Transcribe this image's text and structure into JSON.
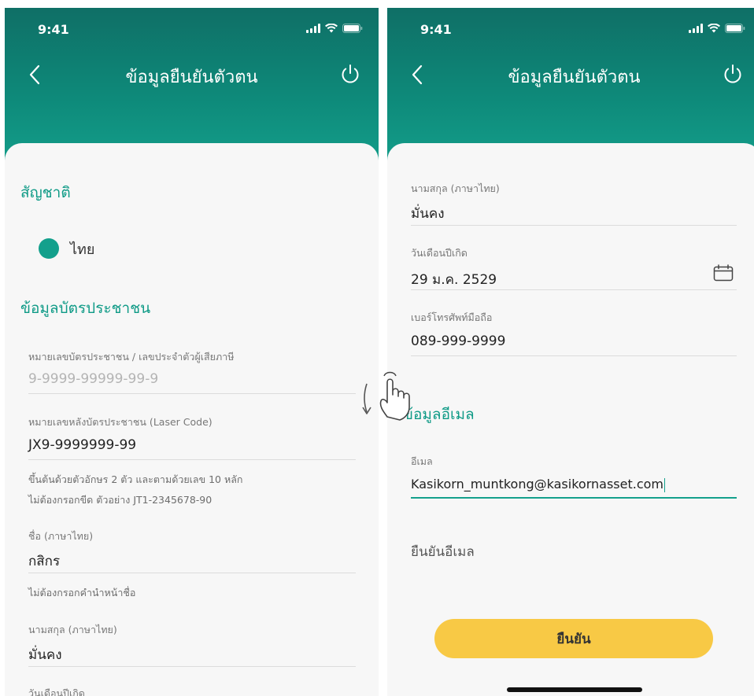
{
  "status_bar": {
    "time": "9:41"
  },
  "header": {
    "title": "ข้อมูลยืนยันตัวตน"
  },
  "left": {
    "nationality": {
      "title": "สัญชาติ",
      "option": "ไทย"
    },
    "id_section_title": "ข้อมูลบัตรประชาชน",
    "id_number": {
      "label": "หมายเลขบัตรประชาชน / เลขประจำตัวผู้เสียภาษี",
      "placeholder": "9-9999-99999-99-9"
    },
    "laser_code": {
      "label": "หมายเลขหลังบัตรประชาชน (Laser Code)",
      "value": "JX9-9999999-99",
      "hint1": "ขึ้นต้นด้วยตัวอักษร 2 ตัว และตามด้วยเลข 10 หลัก",
      "hint2": "ไม่ต้องกรอกขีด  ตัวอย่าง JT1-2345678-90"
    },
    "first_name": {
      "label": "ชื่อ (ภาษาไทย)",
      "value": "กสิกร",
      "hint": "ไม่ต้องกรอกคำนำหน้าชื่อ"
    },
    "last_name": {
      "label": "นามสกุล (ภาษาไทย)",
      "value": "มั่นคง"
    },
    "birthdate_label": "วันเดือนปีเกิด"
  },
  "right": {
    "last_name": {
      "label": "นามสกุล (ภาษาไทย)",
      "value": "มั่นคง"
    },
    "birthdate": {
      "label": "วันเดือนปีเกิด",
      "value": "29 ม.ค. 2529"
    },
    "mobile": {
      "label": "เบอร์โทรศัพท์มือถือ",
      "value": "089-999-9999"
    },
    "email_section_title": "ข้อมูลอีเมล",
    "email": {
      "label": "อีเมล",
      "value": "Kasikorn_muntkong@kasikornasset.com"
    },
    "verify_email": "ยืนยันอีเมล",
    "confirm_button": "ยืนยัน"
  },
  "colors": {
    "header_start": "#0f6f66",
    "header_end": "#14a08c",
    "accent": "#13a08c",
    "button": "#f8c945"
  },
  "icons": [
    "back-icon",
    "power-icon",
    "calendar-icon",
    "wifi-icon",
    "battery-icon",
    "swipe-gesture-icon"
  ]
}
